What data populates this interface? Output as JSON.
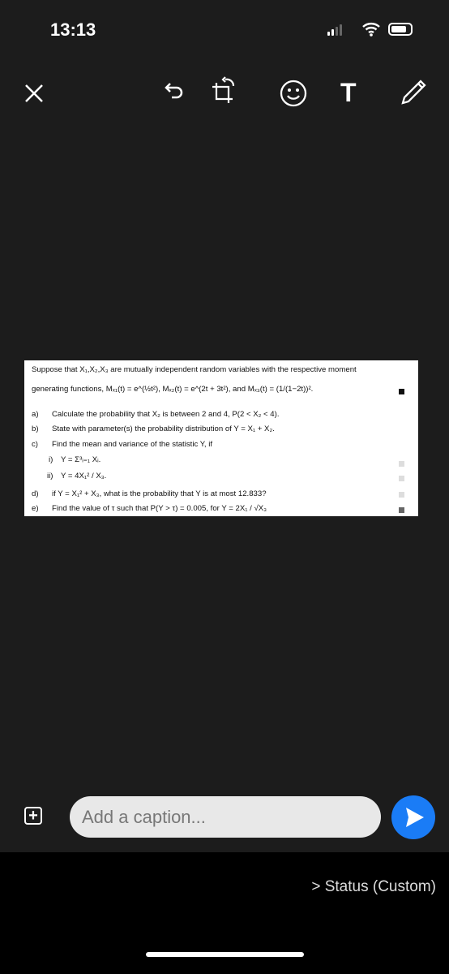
{
  "status_bar": {
    "time": "13:13"
  },
  "toolbar": {
    "icons": [
      "close-icon",
      "undo-icon",
      "crop-rotate-icon",
      "emoji-icon",
      "text-icon",
      "pencil-icon"
    ],
    "text_tool": "T"
  },
  "document": {
    "intro_1": "Suppose that X₁,X₂,X₃ are mutually independent random variables with the respective moment",
    "intro_2": "generating functions, Mₓ₁(t) = e^(½t²), Mₓ₂(t) = e^(2t + 3t²), and Mₓ₃(t) = (1/(1−2t))².",
    "items": [
      {
        "label": "a)",
        "text": "Calculate the probability that X₂ is between 2 and 4, P(2 < X₂ < 4)."
      },
      {
        "label": "b)",
        "text": "State with parameter(s) the probability distribution of Y = X₁ + X₂."
      },
      {
        "label": "c)",
        "text": "Find the mean and variance of the statistic Y, if"
      },
      {
        "label": "i)",
        "text": "Y = Σ³ᵢ₌₁ Xᵢ."
      },
      {
        "label": "ii)",
        "text": "Y = 4X₁² / X₃."
      },
      {
        "label": "d)",
        "text": "if Y = X₁² + X₃, what is the probability that Y is at most 12.833?"
      },
      {
        "label": "e)",
        "text": "Find the value of τ such that P(Y > τ) = 0.005, for Y = 2X₁ / √X₃"
      }
    ]
  },
  "caption": {
    "placeholder": "Add a caption..."
  },
  "status_audience": "> Status (Custom)",
  "colors": {
    "send": "#1a7cf6",
    "background": "#1c1c1c"
  }
}
